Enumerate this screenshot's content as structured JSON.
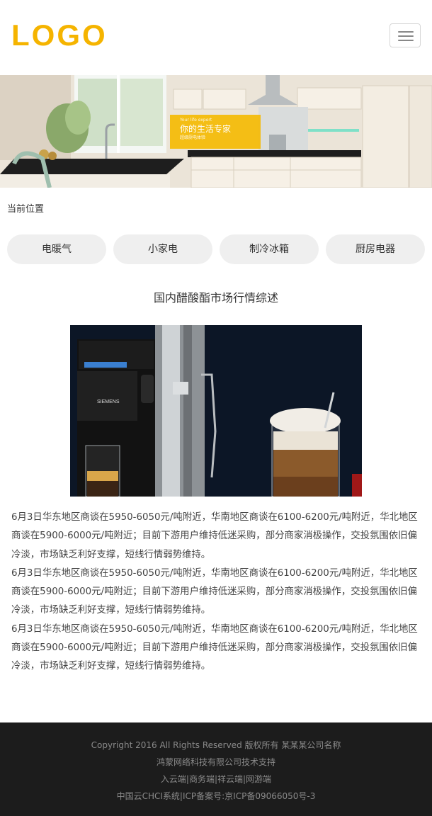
{
  "header": {
    "logo_text": "LOGO",
    "menu_icon": "hamburger-menu-icon",
    "brand_color": "#f5b400"
  },
  "banner": {
    "caption_small": "Your life expert",
    "caption_title": "你的生活专家",
    "caption_sub": "超级厨电体验",
    "accent_color": "#f5b900"
  },
  "breadcrumb": {
    "label": "当前位置"
  },
  "categories": [
    {
      "label": "电暖气"
    },
    {
      "label": "小家电"
    },
    {
      "label": "制冷冰箱"
    },
    {
      "label": "厨房电器"
    }
  ],
  "article": {
    "title": "国内醋酸酯市场行情综述",
    "image_brand_text": "SIEMENS",
    "paragraphs": [
      "6月3日华东地区商谈在5950-6050元/吨附近，华南地区商谈在6100-6200元/吨附近，华北地区商谈在5900-6000元/吨附近；目前下游用户维持低迷采购，部分商家消极操作，交投氛围依旧偏冷淡，市场缺乏利好支撑，短线行情弱势维持。",
      "6月3日华东地区商谈在5950-6050元/吨附近，华南地区商谈在6100-6200元/吨附近，华北地区商谈在5900-6000元/吨附近；目前下游用户维持低迷采购，部分商家消极操作，交投氛围依旧偏冷淡，市场缺乏利好支撑，短线行情弱势维持。",
      "6月3日华东地区商谈在5950-6050元/吨附近，华南地区商谈在6100-6200元/吨附近，华北地区商谈在5900-6000元/吨附近；目前下游用户维持低迷采购，部分商家消极操作，交投氛围依旧偏冷淡，市场缺乏利好支撑，短线行情弱势维持。"
    ]
  },
  "footer": {
    "copyright": "Copyright 2016 All Rights Reserved 版权所有 某某某公司名称",
    "support": "鸿蒙网络科技有限公司技术支持",
    "links": "入云端|商务端|祥云端|网游端",
    "icp": "中国云CHCI系统|ICP备案号:京ICP备09066050号-3"
  }
}
